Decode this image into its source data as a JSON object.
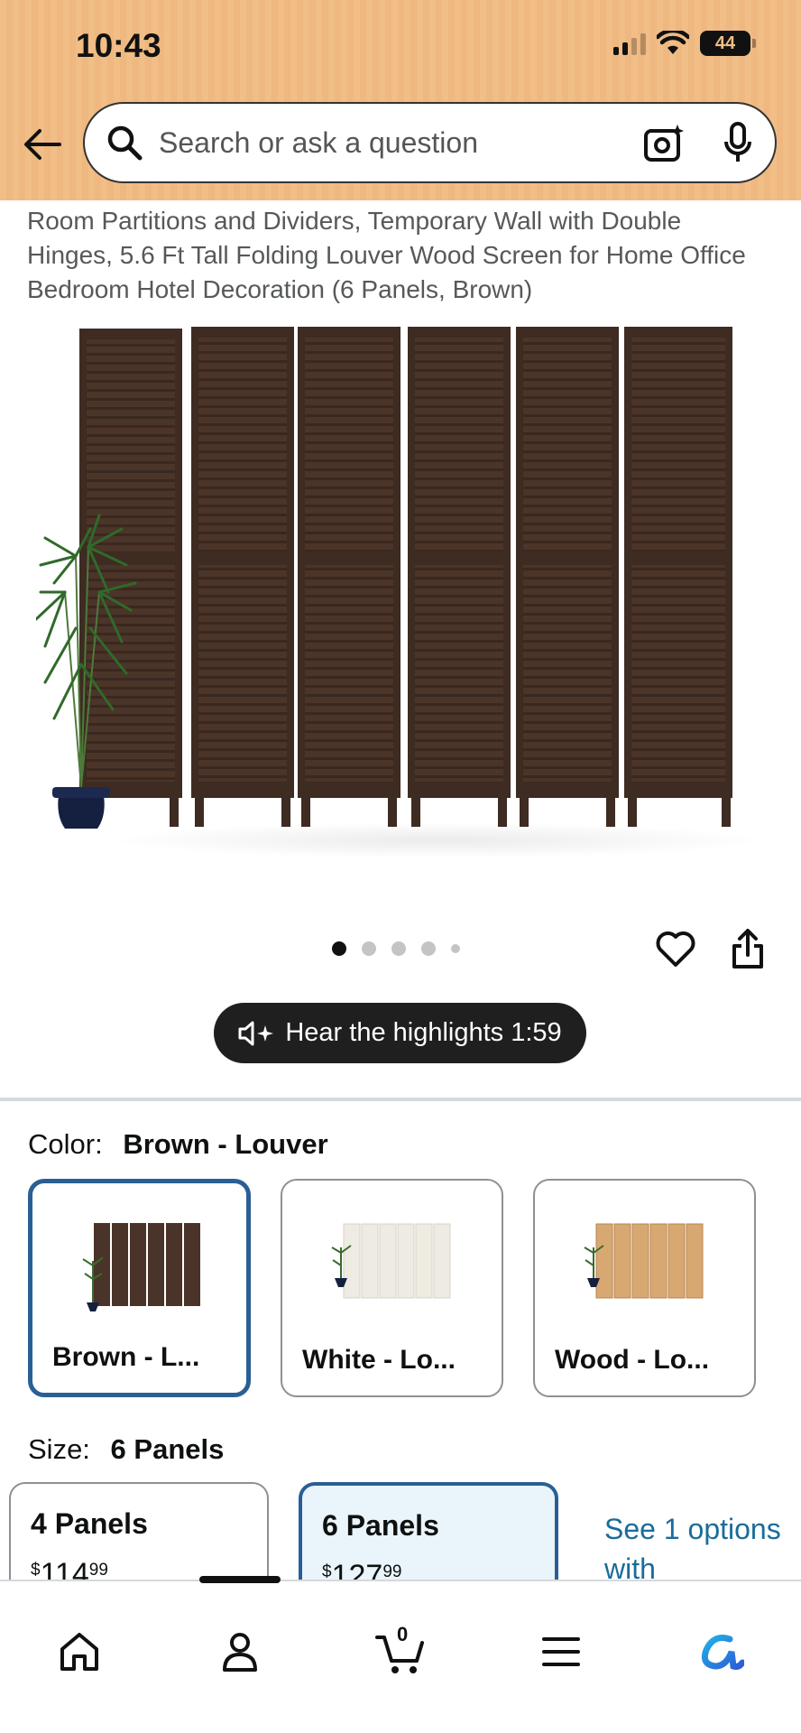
{
  "status_bar": {
    "time": "10:43",
    "battery": "44"
  },
  "search": {
    "placeholder": "Search or ask a question"
  },
  "product": {
    "title": "Room Partitions and Dividers, Temporary Wall with Double Hinges, 5.6 Ft Tall Folding Louver Wood Screen for Home Office Bedroom Hotel Decoration (6 Panels, Brown)",
    "image_count": 5,
    "active_image": 1
  },
  "audio": {
    "label": "Hear the highlights 1:59"
  },
  "color": {
    "label": "Color:",
    "selected": "Brown - Louver",
    "options": [
      {
        "label": "Brown - L...",
        "selected": true
      },
      {
        "label": "White - Lo...",
        "selected": false
      },
      {
        "label": "Wood - Lo...",
        "selected": false
      }
    ]
  },
  "size": {
    "label": "Size:",
    "selected": "6 Panels",
    "options": [
      {
        "label": "4 Panels",
        "price_symbol": "$",
        "price_whole": "114",
        "price_cents": "99",
        "selected": false
      },
      {
        "label": "6 Panels",
        "price_symbol": "$",
        "price_whole": "127",
        "price_cents": "99",
        "selected": true
      }
    ],
    "see_more": "See 1 options with"
  },
  "bottom_nav": {
    "cart_count": "0",
    "active": "profile"
  },
  "colors": {
    "header_bg": "#f0be86",
    "selected_border": "#2a5f95",
    "link": "#1a6c9a",
    "panel_brown": "#4a3328"
  }
}
